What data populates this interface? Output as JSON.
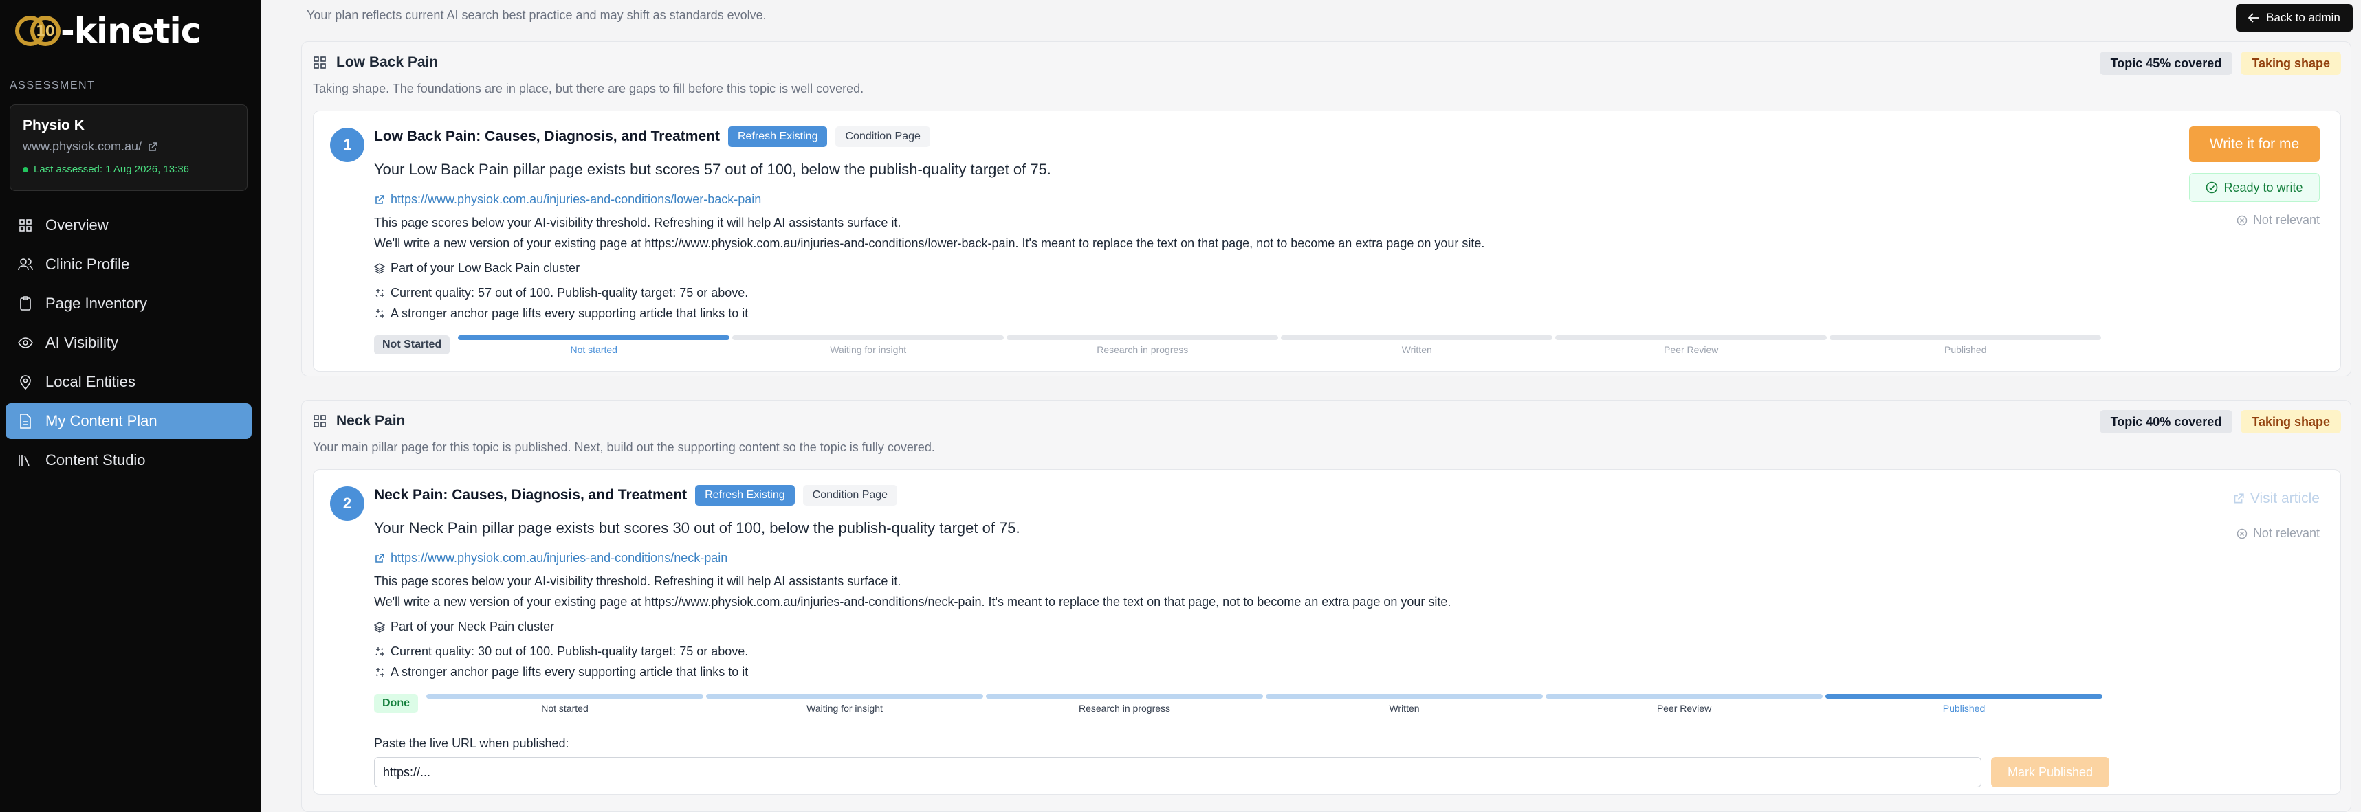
{
  "app": {
    "brand": "-kinetic",
    "brand_mark_number": "10",
    "section_label": "ASSESSMENT",
    "clinic": {
      "name": "Physio K",
      "url": "www.physiok.com.au/",
      "assessed": "Last assessed: 1 Aug 2026, 13:36"
    },
    "nav": [
      {
        "label": "Overview",
        "icon": "grid-icon"
      },
      {
        "label": "Clinic Profile",
        "icon": "users-icon"
      },
      {
        "label": "Page Inventory",
        "icon": "clipboard-icon"
      },
      {
        "label": "AI Visibility",
        "icon": "eye-icon"
      },
      {
        "label": "Local Entities",
        "icon": "map-pin-icon"
      },
      {
        "label": "My Content Plan",
        "icon": "document-icon",
        "active": true
      },
      {
        "label": "Content Studio",
        "icon": "library-icon"
      }
    ]
  },
  "header": {
    "plan_note": "Your plan reflects current AI search best practice and may shift as standards evolve.",
    "back_label": "Back to admin"
  },
  "topics": [
    {
      "name": "Low Back Pain",
      "subtitle": "Taking shape. The foundations are in place, but there are gaps to fill before this topic is well covered.",
      "coverage": "Topic 45% covered",
      "status": "Taking shape",
      "card": {
        "number": "1",
        "title": "Low Back Pain: Causes, Diagnosis, and Treatment",
        "tag_action": "Refresh Existing",
        "tag_type": "Condition Page",
        "summary": "Your Low Back Pain pillar page exists but scores 57 out of 100, below the publish-quality target of 75.",
        "link": "https://www.physiok.com.au/injuries-and-conditions/lower-back-pain",
        "line1": "This page scores below your AI-visibility threshold. Refreshing it will help AI assistants surface it.",
        "line2": "We'll write a new version of your existing page at https://www.physiok.com.au/injuries-and-conditions/lower-back-pain. It's meant to replace the text on that page, not to become an extra page on your site.",
        "cluster": "Part of your Low Back Pain cluster",
        "quality": "Current quality: 57 out of 100. Publish-quality target: 75 or above.",
        "anchor": "A stronger anchor page lifts every supporting article that links to it",
        "stage_chip": "Not Started",
        "stages": [
          "Not started",
          "Waiting for insight",
          "Research in progress",
          "Written",
          "Peer Review",
          "Published"
        ],
        "active_stage": 0,
        "write_label": "Write it for me",
        "ready_label": "Ready to write",
        "not_relevant": "Not relevant"
      }
    },
    {
      "name": "Neck Pain",
      "subtitle": "Your main pillar page for this topic is published. Next, build out the supporting content so the topic is fully covered.",
      "coverage": "Topic 40% covered",
      "status": "Taking shape",
      "card": {
        "number": "2",
        "title": "Neck Pain: Causes, Diagnosis, and Treatment",
        "tag_action": "Refresh Existing",
        "tag_type": "Condition Page",
        "summary": "Your Neck Pain pillar page exists but scores 30 out of 100, below the publish-quality target of 75.",
        "link": "https://www.physiok.com.au/injuries-and-conditions/neck-pain",
        "line1": "This page scores below your AI-visibility threshold. Refreshing it will help AI assistants surface it.",
        "line2": "We'll write a new version of your existing page at https://www.physiok.com.au/injuries-and-conditions/neck-pain. It's meant to replace the text on that page, not to become an extra page on your site.",
        "cluster": "Part of your Neck Pain cluster",
        "quality": "Current quality: 30 out of 100. Publish-quality target: 75 or above.",
        "anchor": "A stronger anchor page lifts every supporting article that links to it",
        "stage_chip": "Done",
        "stages": [
          "Not started",
          "Waiting for insight",
          "Research in progress",
          "Written",
          "Peer Review",
          "Published"
        ],
        "active_stage": 5,
        "visit_label": "Visit article",
        "not_relevant": "Not relevant",
        "paste_label": "Paste the live URL when published:",
        "url_value": "https://...",
        "mark_label": "Mark Published"
      }
    }
  ]
}
